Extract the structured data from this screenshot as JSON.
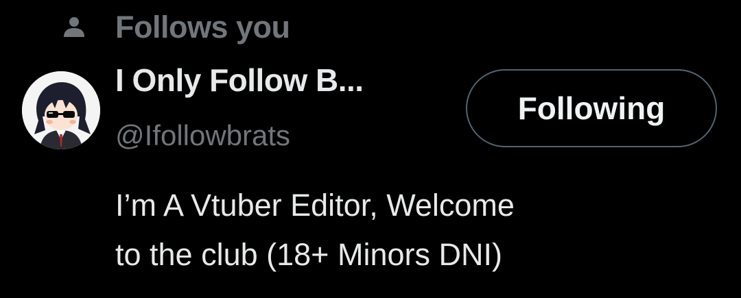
{
  "follows_you": {
    "icon": "person-icon",
    "label": "Follows you"
  },
  "user": {
    "avatar": "anime-avatar-with-sunglasses",
    "display_name": "I Only Follow B...",
    "handle": "@Ifollowbrats",
    "bio_line1": "I’m A Vtuber Editor, Welcome",
    "bio_line2": "to the club (18+ Minors DNI)"
  },
  "actions": {
    "following_label": "Following"
  },
  "colors": {
    "background": "#000000",
    "primary_text": "#e7e9ea",
    "secondary_text": "#71767b",
    "button_border": "#536471"
  }
}
